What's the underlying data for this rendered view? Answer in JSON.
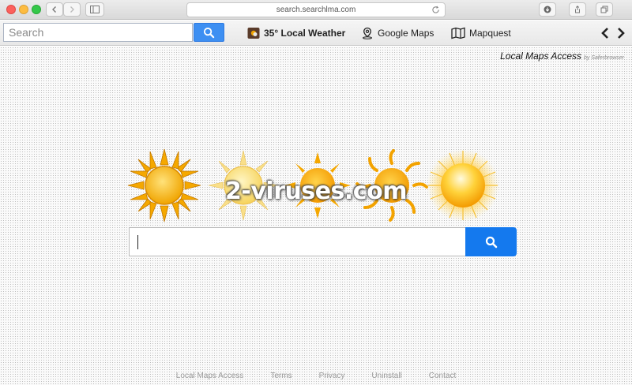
{
  "browser": {
    "url": "search.searchlma.com"
  },
  "toolbar": {
    "search_placeholder": "Search",
    "weather_temp": "35°",
    "weather_label": "Local Weather",
    "google_maps_label": "Google Maps",
    "mapquest_label": "Mapquest"
  },
  "branding": {
    "title": "Local Maps Access",
    "byline": "by Saferbrowser"
  },
  "watermark": "2-viruses.com",
  "footer": {
    "links": [
      "Local Maps Access",
      "Terms",
      "Privacy",
      "Uninstall",
      "Contact"
    ]
  },
  "colors": {
    "accent_button": "#1479ee",
    "toolbar_button": "#3d8ff2",
    "sun_gold": "#f5a800"
  },
  "icons": [
    "back-icon",
    "forward-icon",
    "sidebar-icon",
    "reload-icon",
    "download-icon",
    "share-icon",
    "tabs-icon",
    "search-icon",
    "weather-icon",
    "map-pin-icon",
    "map-icon",
    "chevron-left-icon",
    "chevron-right-icon"
  ]
}
